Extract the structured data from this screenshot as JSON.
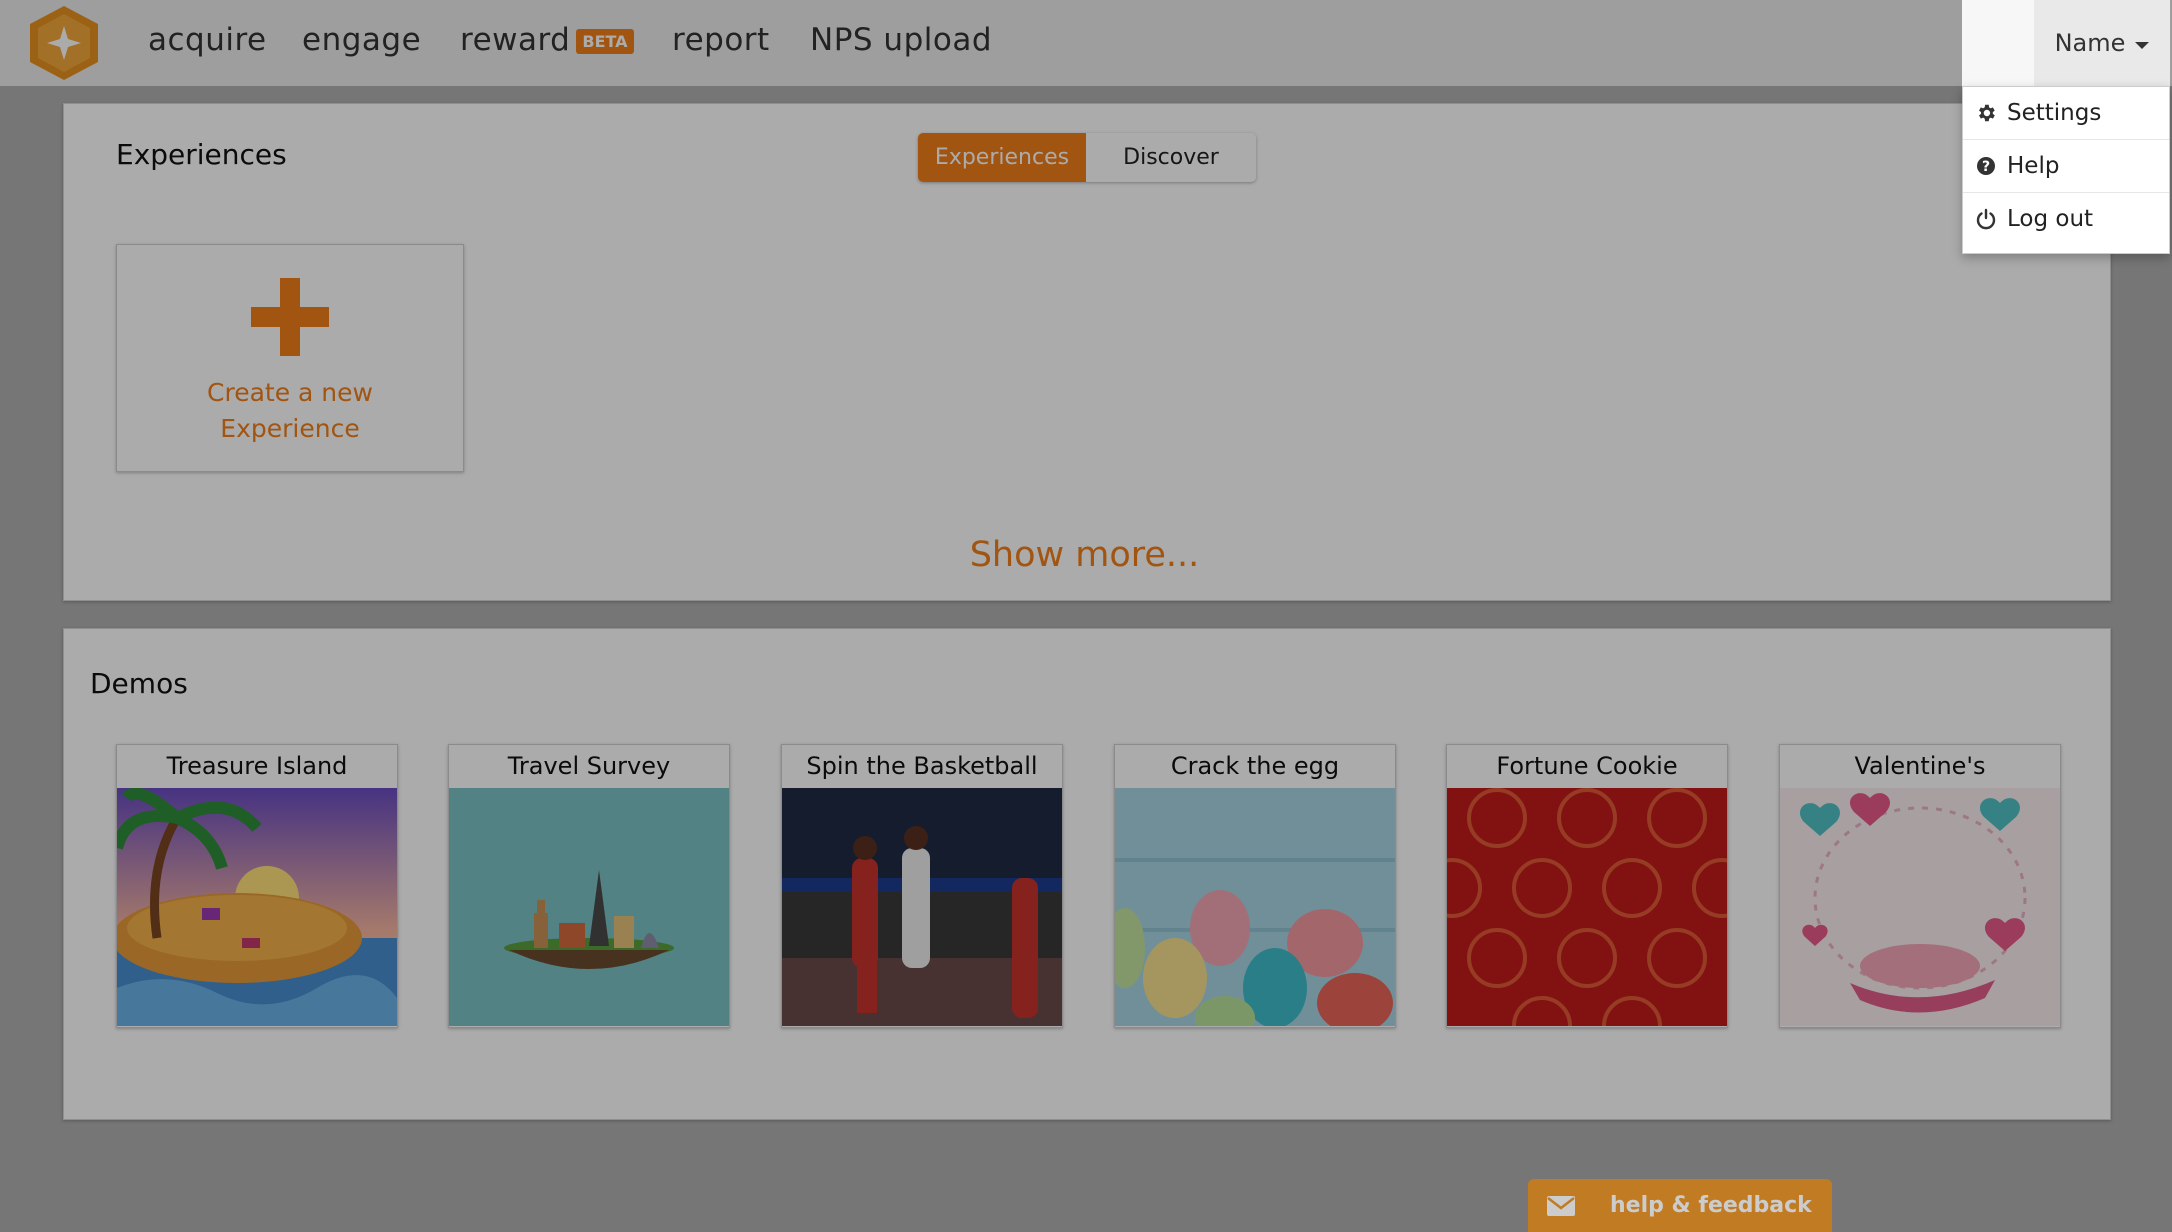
{
  "nav": {
    "items": [
      {
        "label": "acquire"
      },
      {
        "label": "engage"
      },
      {
        "label": "reward",
        "badge": "BETA"
      },
      {
        "label": "report"
      },
      {
        "label": "NPS upload"
      }
    ],
    "user_menu_label": "Name",
    "user_menu_items": [
      {
        "label": "Settings",
        "icon": "gear-icon"
      },
      {
        "label": "Help",
        "icon": "question-circle-icon"
      },
      {
        "label": "Log out",
        "icon": "power-icon"
      }
    ]
  },
  "experiences": {
    "title": "Experiences",
    "tabs": [
      {
        "label": "Experiences",
        "active": true
      },
      {
        "label": "Discover",
        "active": false
      }
    ],
    "create_label": "Create a new Experience",
    "show_more": "Show more..."
  },
  "demos": {
    "title": "Demos",
    "items": [
      {
        "title": "Treasure Island"
      },
      {
        "title": "Travel Survey"
      },
      {
        "title": "Spin the Basketball"
      },
      {
        "title": "Crack the egg"
      },
      {
        "title": "Fortune Cookie"
      },
      {
        "title": "Valentine's"
      }
    ]
  },
  "feedback": {
    "label": "help & feedback",
    "icon": "envelope-icon"
  },
  "colors": {
    "accent": "#f07f1a",
    "feedback": "#f29b2c"
  }
}
